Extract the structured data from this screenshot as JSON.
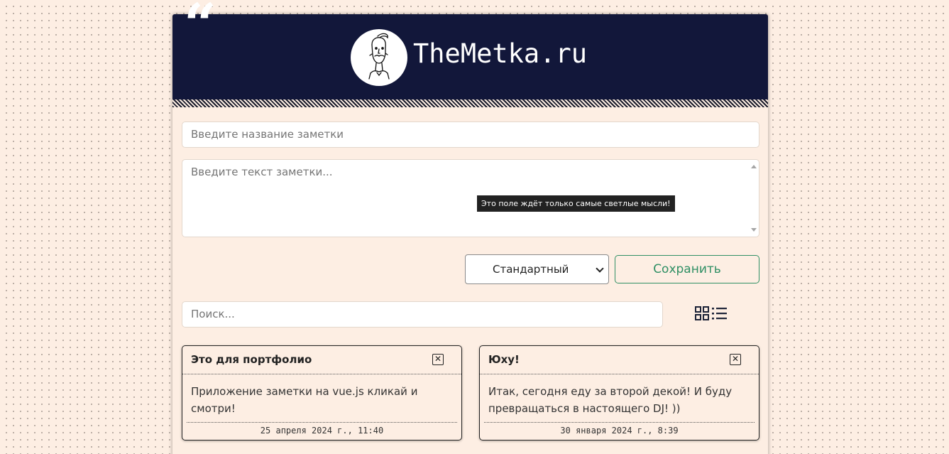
{
  "header": {
    "site_title": "TheMetka.ru",
    "logo_icon": "bearded-man-illustration"
  },
  "form": {
    "title_placeholder": "Введите название заметки",
    "text_placeholder": "Введите текст заметки...",
    "tooltip": "Это поле ждёт только самые светлые мысли!",
    "priority_selected": "Стандартный",
    "save_label": "Сохранить"
  },
  "search": {
    "placeholder": "Поиск..."
  },
  "view_toggle": {
    "grid_icon": "grid-view-icon",
    "list_icon": "list-view-icon"
  },
  "notes": [
    {
      "title": "Это для портфолио",
      "text": "Приложение заметки на vue.js кликай и смотри!",
      "date": "25 апреля 2024 г., 11:40"
    },
    {
      "title": "Юху!",
      "text": "Итак, сегодня еду за второй декой! И буду превращаться в настоящего DJ! ))",
      "date": "30 января 2024 г., 8:39"
    }
  ],
  "colors": {
    "header_bg": "#12173a",
    "page_bg": "#fdeee3",
    "accent_green": "#2f8f64"
  }
}
